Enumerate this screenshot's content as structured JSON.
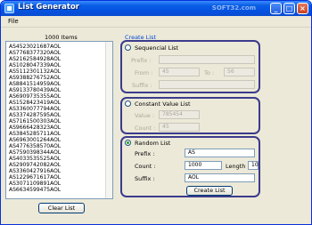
{
  "window": {
    "title": "List Generator",
    "watermark": "SOFT32.com",
    "controls": [
      "_",
      "□",
      "×"
    ]
  },
  "menu": {
    "file": "File"
  },
  "left": {
    "count_label": "1000 Items",
    "items": [
      "AS4523021687AOL",
      "AS7768377320AOL",
      "AS2162584928AOL",
      "AS1028047339AOL",
      "AS5112301132AOL",
      "AS9388276752AOL",
      "AS8841514959AOL",
      "AS9133780439AOL",
      "AS6909735355AOL",
      "AS1528423419AOL",
      "AS3360077794AOL",
      "AS3374287595AOL",
      "AS7161500303AOL",
      "AS9666428323AOL",
      "AS3845285711AOL",
      "AS6963001264AOL",
      "AS4776358570AOL",
      "AS7590398344AOL",
      "AS4033535525AOL",
      "AS2909742082AOL",
      "AS3360427916AOL",
      "AS1229671617AOL",
      "AS3071109891AOL",
      "AS6634599475AOL"
    ],
    "clear_button": "Clear List"
  },
  "right": {
    "create_list_label": "Create List",
    "sequential": {
      "title": "Sequencial List",
      "prefix_label": "Prefix :",
      "prefix_value": "",
      "from_label": "From :",
      "from_value": "45",
      "to_label": "To :",
      "to_value": "56",
      "suffix_label": "Suffix :",
      "suffix_value": ""
    },
    "constant": {
      "title": "Constant Value List",
      "value_label": "Value :",
      "value_value": "785454",
      "count_label": "Count :",
      "count_value": "45"
    },
    "random": {
      "title": "Random List",
      "prefix_label": "Prefix :",
      "prefix_value": "AS",
      "count_label": "Count :",
      "count_value": "1000",
      "length_label": "Length :",
      "length_value": "10",
      "suffix_label": "Suffix :",
      "suffix_value": "AOL",
      "create_button": "Create List"
    }
  }
}
